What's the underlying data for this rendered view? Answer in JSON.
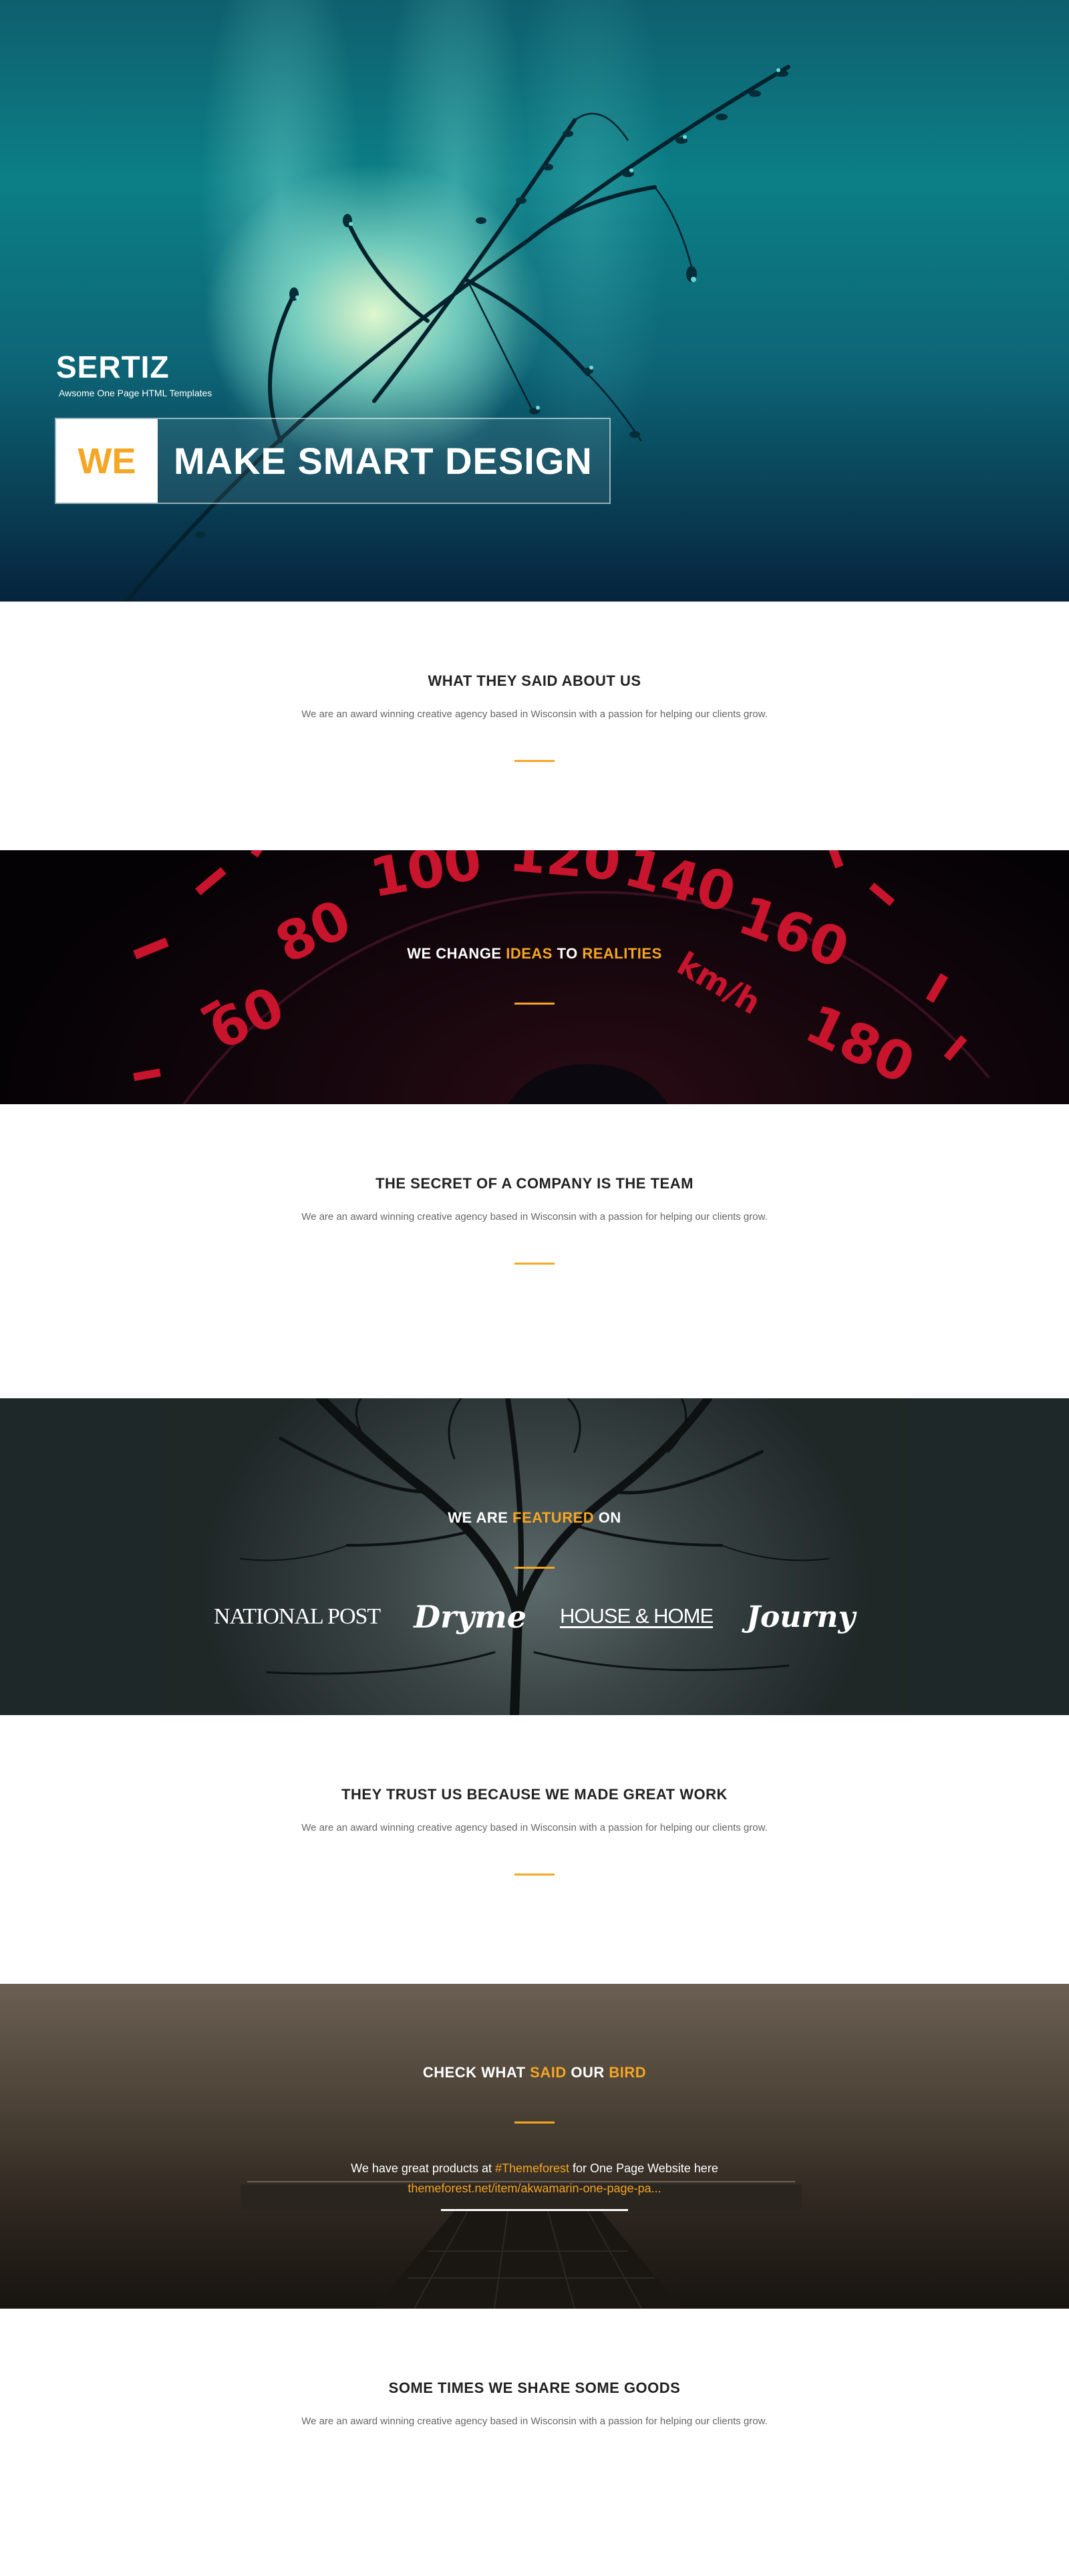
{
  "hero": {
    "brand_name": "SERTIZ",
    "brand_tagline": "Awsome One Page HTML Templates",
    "headline_highlight": "WE",
    "headline_rest": "MAKE SMART DESIGN"
  },
  "testimonials": {
    "title": "WHAT THEY SAID ABOUT US",
    "description": "We are an award winning creative agency based in Wisconsin with a passion for helping our clients grow."
  },
  "change": {
    "title_parts": [
      "WE CHANGE ",
      "IDEAS",
      " TO ",
      "REALITIES"
    ],
    "speedometer_marks": [
      "60",
      "80",
      "100",
      "120",
      "140",
      "160",
      "180",
      "km/h"
    ]
  },
  "team": {
    "title": "THE SECRET OF A COMPANY IS THE TEAM",
    "description": "We are an award winning creative agency based in Wisconsin with a passion for helping our clients grow."
  },
  "featured": {
    "title_parts": [
      "WE ARE ",
      "FEATURED",
      " ON"
    ],
    "logos": [
      "NATIONAL POST",
      "Dryme",
      "HOUSE & HOME",
      "Journy"
    ]
  },
  "work": {
    "title": "THEY TRUST US BECAUSE WE MADE GREAT WORK",
    "description": "We are an award winning creative agency based in Wisconsin with a passion for helping our clients grow."
  },
  "bird": {
    "title_parts": [
      "CHECK WHAT ",
      "SAID",
      " OUR ",
      "BIRD"
    ],
    "tweet_before": "We have great products at ",
    "tweet_hashtag": "#Themeforest",
    "tweet_after": " for One Page Website here",
    "tweet_link": "themeforest.net/item/akwamarin-one-page-pa..."
  },
  "goods": {
    "title": "SOME TIMES WE SHARE SOME GOODS",
    "description": "We are an award winning creative agency based in Wisconsin with a passion for helping our clients grow."
  },
  "colors": {
    "accent": "#f5a623"
  }
}
